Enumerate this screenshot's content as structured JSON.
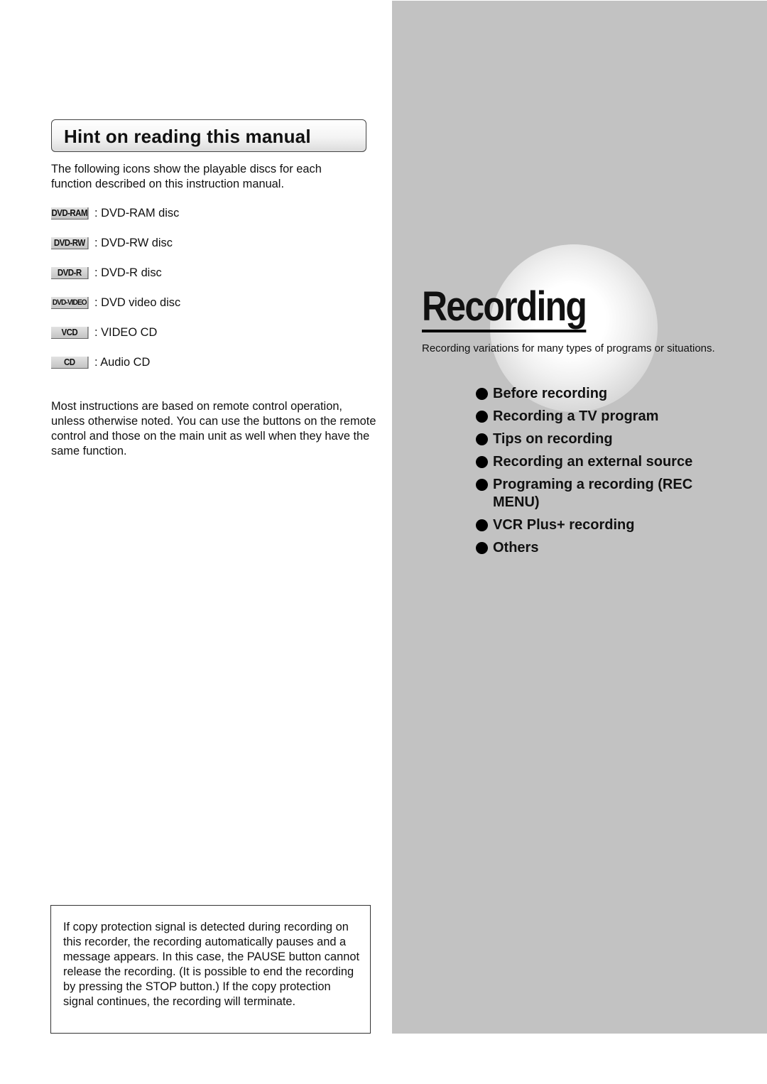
{
  "left": {
    "hint_title": "Hint on reading this manual",
    "intro": "The following icons show the playable discs for each function described on this instruction manual.",
    "discs": [
      {
        "icon": "DVD-RAM",
        "label": ": DVD-RAM disc"
      },
      {
        "icon": "DVD-RW",
        "label": ": DVD-RW disc"
      },
      {
        "icon": "DVD-R",
        "label": ": DVD-R disc"
      },
      {
        "icon": "DVD-VIDEO",
        "label": ": DVD video disc"
      },
      {
        "icon": "VCD",
        "label": ": VIDEO CD"
      },
      {
        "icon": "CD",
        "label": ": Audio CD"
      }
    ],
    "remote_note": "Most instructions are based on remote control operation, unless otherwise noted.  You can use the buttons on the remote control and those on the main unit as well when they have the same function.",
    "copy_protection_note": "If copy protection signal is detected during recording on this recorder, the recording automatically pauses and a message appears. In this case, the PAUSE button cannot release the recording. (It is possible to end the recording by pressing the STOP button.) If the copy protection signal continues, the recording will terminate."
  },
  "right": {
    "title": "Recording",
    "subtitle": "Recording variations for many types of programs or situations.",
    "topics": [
      "Before recording",
      "Recording a TV program",
      "Tips on recording",
      "Recording an external source",
      "Programing a recording (REC MENU)",
      "VCR Plus+ recording",
      "Others"
    ]
  }
}
